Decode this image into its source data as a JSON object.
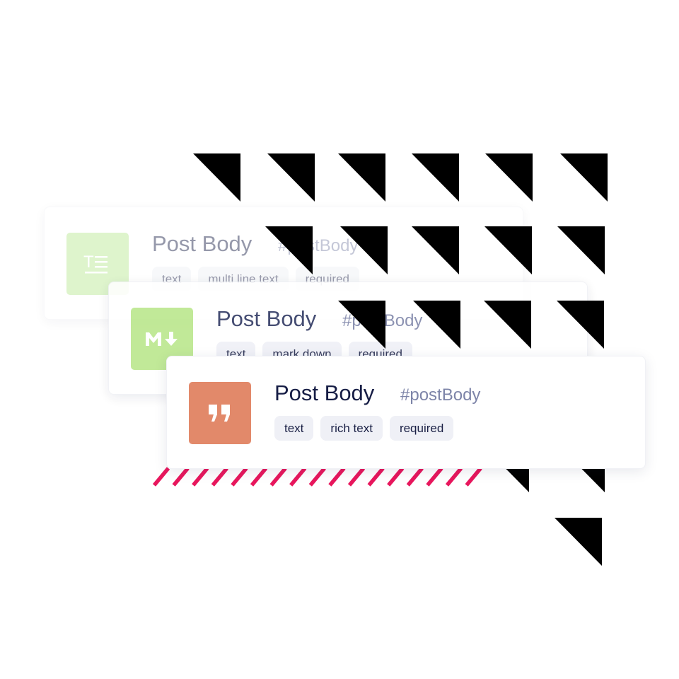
{
  "colors": {
    "accent_stripes": "#e8175d",
    "triangles": "#000000",
    "tag_bg": "#eff0f6"
  },
  "cards": [
    {
      "title": "Post Body",
      "api_id": "#postBody",
      "icon": "text-lines-icon",
      "icon_color": "#b8e890",
      "tags": [
        "text",
        "multi line text",
        "required"
      ]
    },
    {
      "title": "Post Body",
      "api_id": "#postBody",
      "icon": "markdown-icon",
      "icon_color": "#b9e68a",
      "tags": [
        "text",
        "mark down",
        "required"
      ]
    },
    {
      "title": "Post Body",
      "api_id": "#postBody",
      "icon": "quote-icon",
      "icon_color": "#e2896a",
      "tags": [
        "text",
        "rich text",
        "required"
      ]
    }
  ]
}
